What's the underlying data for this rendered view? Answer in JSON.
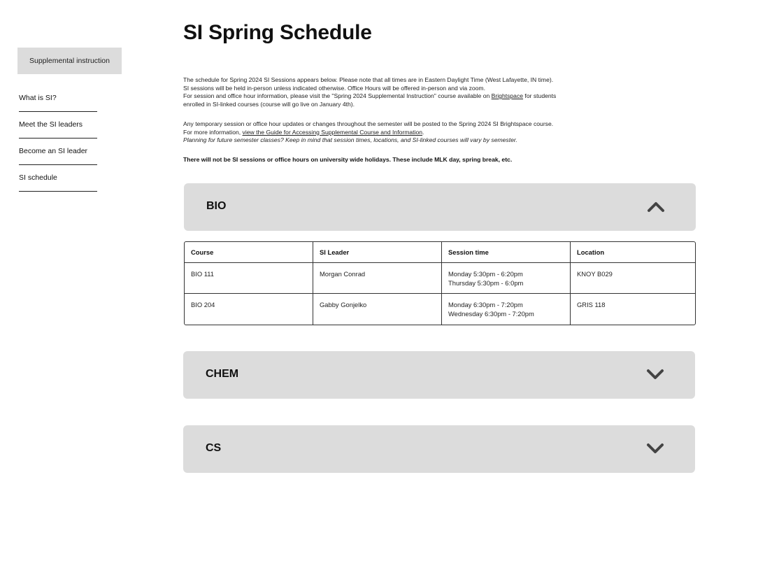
{
  "sidebar": {
    "header": "Supplemental instruction",
    "items": [
      "What is SI?",
      "Meet the SI leaders",
      "Become an SI leader",
      "SI schedule"
    ]
  },
  "main": {
    "title": "SI Spring Schedule",
    "intro": {
      "line1": "The schedule for Spring 2024 SI Sessions appears below. Please note that all times are in Eastern Daylight Time (West Lafayette, IN time).",
      "line2": "SI sessions will be held in-person unless indicated otherwise. Office Hours will be offered in-person and via zoom.",
      "line3_pre": "For session and office hour information, please visit the \"Spring 2024 Supplemental Instruction\" course available on ",
      "line3_link": "Brightspace",
      "line3_post": " for students",
      "line4": "enrolled in SI-linked courses (course will go live on January 4th).",
      "line5": "Any temporary session or office hour updates or changes throughout the semester will be posted to the Spring 2024 SI Brightspace course.",
      "line6_pre": "For more information, ",
      "line6_link": "view the Guide for Accessing Supplemental Course and Information",
      "line6_post": ".",
      "line7": "Planning for future semester classes? Keep in mind that session times, locations, and SI-linked courses will vary by semester."
    },
    "holiday_notice": "There will not be SI sessions or office hours on university wide holidays. These include MLK day, spring break,  etc.",
    "sections": [
      {
        "name": "BIO",
        "expanded": true,
        "table": {
          "headers": [
            "Course",
            "SI Leader",
            "Session time",
            "Location"
          ],
          "rows": [
            {
              "course": "BIO 111",
              "leader": "Morgan Conrad",
              "time1": "Monday 5:30pm - 6:20pm",
              "time2": "Thursday 5:30pm - 6:0pm",
              "location": "KNOY B029"
            },
            {
              "course": "BIO 204",
              "leader": "Gabby Gonjelko",
              "time1": "Monday 6:30pm - 7:20pm",
              "time2": "Wednesday  6:30pm - 7:20pm",
              "location": "GRIS 118"
            }
          ]
        }
      },
      {
        "name": "CHEM",
        "expanded": false
      },
      {
        "name": "CS",
        "expanded": false
      }
    ]
  },
  "icons": {
    "expanded": "chevron-up-icon",
    "collapsed": "chevron-down-icon"
  },
  "colors": {
    "panel": "#dcdcdc",
    "chevron": "#444444",
    "text": "#111111"
  }
}
